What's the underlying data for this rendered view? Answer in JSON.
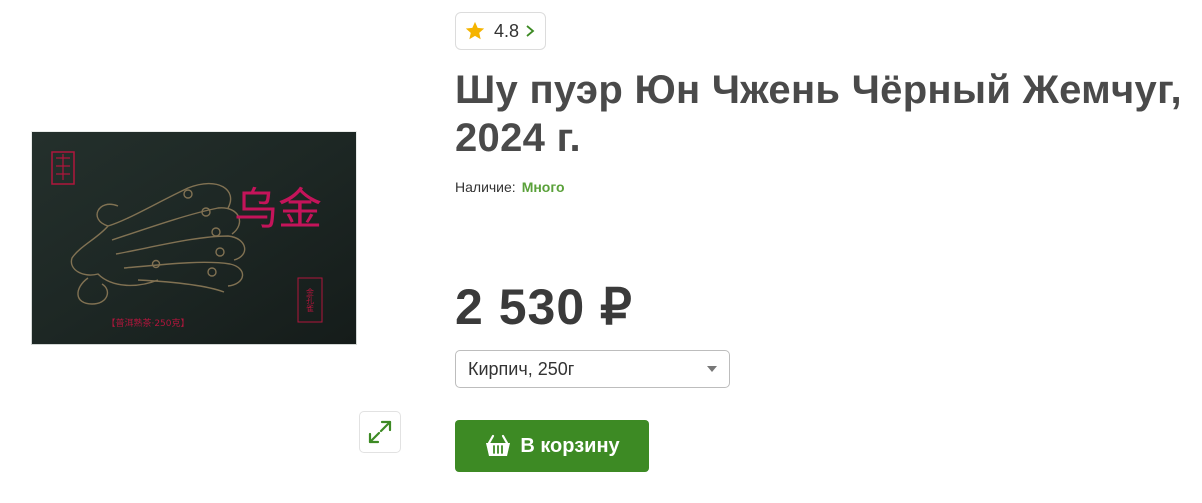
{
  "gallery": {
    "image_alt_icon": "tea-brick-package-image",
    "zoom_icon": "expand-arrows-icon",
    "package_label": "【普洱熟茶·250克】",
    "package_big_chars": "乌金",
    "package_stamp": "金孔雀"
  },
  "product": {
    "rating": "4.8",
    "title": "Шу пуэр Юн Чжень Чёрный Жемчуг, 2024 г.",
    "availability_label": "Наличие:",
    "availability_value": "Много",
    "price": "2 530 ₽",
    "variant_selected": "Кирпич, 250г",
    "add_to_cart_label": "В корзину"
  },
  "colors": {
    "accent_green": "#3d8a24",
    "availability_green": "#5aa13a",
    "star": "#f5b400",
    "title": "#4a4a4a"
  }
}
